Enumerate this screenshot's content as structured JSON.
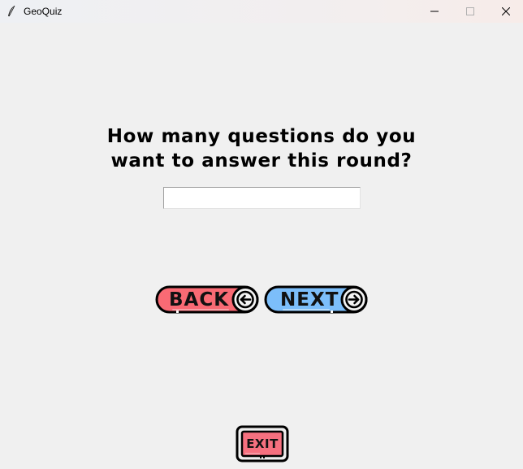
{
  "window": {
    "title": "GeoQuiz",
    "icon": "feather-icon",
    "controls": [
      "minimize-icon",
      "maximize-icon",
      "close-icon"
    ]
  },
  "question": {
    "line1": "How many questions do you",
    "line2": "want to answer this round?"
  },
  "answer_input": {
    "value": "",
    "placeholder": ""
  },
  "buttons": {
    "back_label": "BACK",
    "next_label": "NEXT",
    "exit_label": "EXIT"
  },
  "colors": {
    "back_fill": "#f96a74",
    "next_fill": "#7cbefa",
    "exit_fill": "#f6707f",
    "outline": "#000000",
    "background": "#f0f0f0"
  }
}
